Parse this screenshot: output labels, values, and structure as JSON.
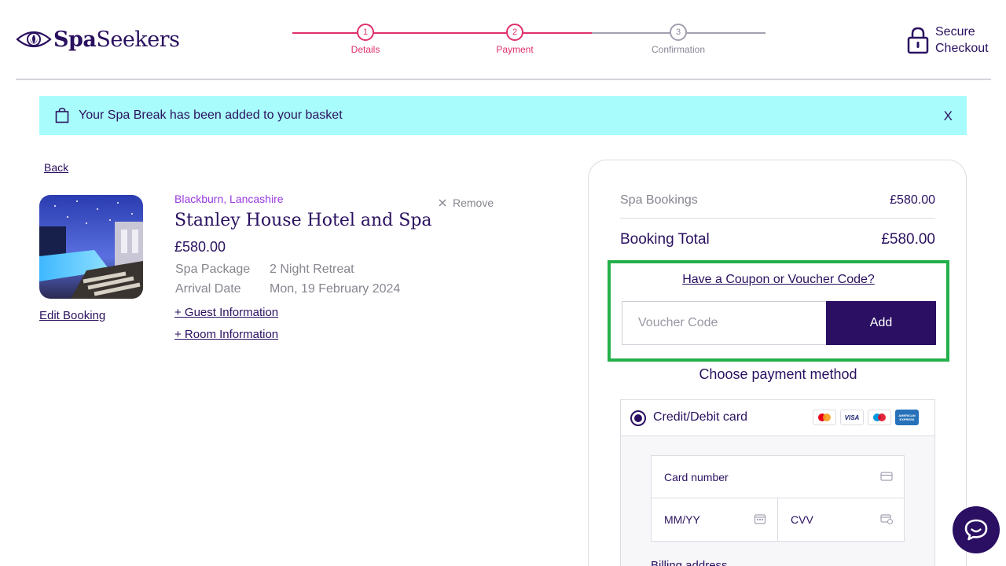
{
  "brand": {
    "name_bold": "Spa",
    "name_rest": "Seekers"
  },
  "stepper": {
    "steps": [
      {
        "number": "1",
        "label": "Details"
      },
      {
        "number": "2",
        "label": "Payment"
      },
      {
        "number": "3",
        "label": "Confirmation"
      }
    ]
  },
  "secure": {
    "line1": "Secure",
    "line2": "Checkout"
  },
  "banner": {
    "message": "Your Spa Break has been added to your basket",
    "close_label": "X"
  },
  "booking": {
    "back_label": "Back",
    "edit_label": "Edit Booking",
    "location": "Blackburn, Lancashire",
    "hotel_name": "Stanley House Hotel and Spa",
    "price": "£580.00",
    "remove_label": "Remove",
    "details": [
      {
        "key": "Spa Package",
        "value": "2 Night Retreat"
      },
      {
        "key": "Arrival Date",
        "value": "Mon, 19 February 2024"
      }
    ],
    "guest_info_label": "+ Guest Information",
    "room_info_label": "+ Room Information"
  },
  "summary": {
    "spa_bookings_label": "Spa Bookings",
    "spa_bookings_value": "£580.00",
    "total_label": "Booking Total",
    "total_value": "£580.00",
    "coupon_link": "Have a Coupon or Voucher Code?",
    "voucher_placeholder": "Voucher Code",
    "add_label": "Add",
    "payment_title": "Choose payment method",
    "card_option_label": "Credit/Debit card",
    "card_brands": [
      "mastercard",
      "VISA",
      "maestro",
      "AMERICAN EXPRESS"
    ],
    "card_number_label": "Card number",
    "expiry_label": "MM/YY",
    "cvv_label": "CVV",
    "billing_label": "Billing address"
  },
  "colors": {
    "accent": "#e0306a",
    "brand_dark": "#2a0f63",
    "banner_bg": "#a9fcfc",
    "highlight": "#22b04a"
  }
}
